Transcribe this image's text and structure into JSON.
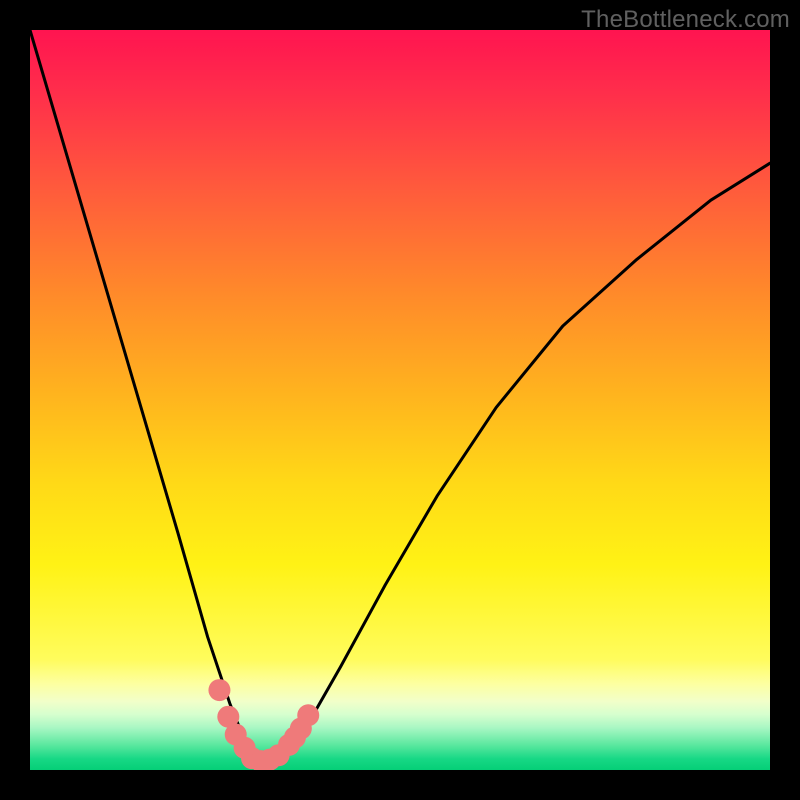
{
  "watermark": "TheBottleneck.com",
  "chart_data": {
    "type": "line",
    "title": "",
    "xlabel": "",
    "ylabel": "",
    "xlim": [
      0,
      1
    ],
    "ylim": [
      0,
      1
    ],
    "grid": false,
    "legend": false,
    "series": [
      {
        "name": "bottleneck-curve",
        "x": [
          0.0,
          0.05,
          0.1,
          0.15,
          0.2,
          0.24,
          0.27,
          0.29,
          0.305,
          0.315,
          0.33,
          0.35,
          0.38,
          0.42,
          0.48,
          0.55,
          0.63,
          0.72,
          0.82,
          0.92,
          1.0
        ],
        "y": [
          1.0,
          0.83,
          0.66,
          0.49,
          0.32,
          0.18,
          0.09,
          0.04,
          0.015,
          0.01,
          0.014,
          0.03,
          0.07,
          0.14,
          0.25,
          0.37,
          0.49,
          0.6,
          0.69,
          0.77,
          0.82
        ]
      },
      {
        "name": "highlight-dots-left",
        "x": [
          0.256,
          0.268,
          0.278,
          0.29
        ],
        "y": [
          0.108,
          0.072,
          0.048,
          0.03
        ]
      },
      {
        "name": "highlight-dots-bottom",
        "x": [
          0.3,
          0.312,
          0.324,
          0.336
        ],
        "y": [
          0.016,
          0.012,
          0.014,
          0.02
        ]
      },
      {
        "name": "highlight-dots-right",
        "x": [
          0.35,
          0.358,
          0.366,
          0.376
        ],
        "y": [
          0.034,
          0.044,
          0.056,
          0.074
        ]
      }
    ],
    "notes": "Axes are normalized 0-1; no tick labels or axis titles are visible in the image; y=0 is bottom, y=1 is top"
  }
}
